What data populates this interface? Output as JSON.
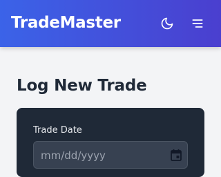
{
  "header": {
    "brand": "TradeMaster",
    "theme_toggle_icon": "moon-icon",
    "menu_icon": "hamburger-menu-icon"
  },
  "main": {
    "title": "Log New Trade",
    "form": {
      "trade_date": {
        "label": "Trade Date",
        "value": "",
        "placeholder": "mm/dd/yyyy",
        "icon": "calendar-icon"
      }
    }
  },
  "colors": {
    "header_gradient_start": "#3b63e8",
    "header_gradient_end": "#4a3fcf",
    "page_background": "#f3f4f6",
    "card_background": "#1f2937",
    "input_background": "#374151"
  }
}
